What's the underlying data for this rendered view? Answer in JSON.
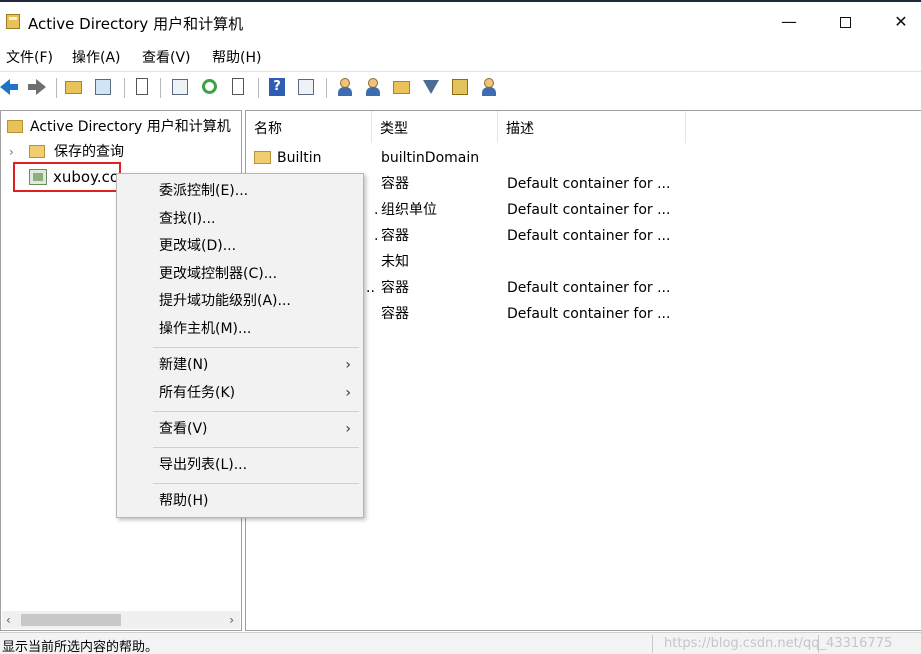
{
  "window": {
    "title": "Active Directory 用户和计算机",
    "minimize": "—",
    "close": "✕"
  },
  "menubar": [
    "文件(F)",
    "操作(A)",
    "查看(V)",
    "帮助(H)"
  ],
  "tree": {
    "root": "Active Directory 用户和计算机",
    "saved_queries": "保存的查询",
    "domain": "xuboy.co"
  },
  "list": {
    "columns": [
      "名称",
      "类型",
      "描述"
    ],
    "rows": [
      {
        "name": "Builtin",
        "type": "builtinDomain",
        "desc": ""
      },
      {
        "name": "",
        "type": "容器",
        "desc": "Default container for ..."
      },
      {
        "name": ".",
        "type": "组织单位",
        "desc": "Default container for ..."
      },
      {
        "name": ".",
        "type": "容器",
        "desc": "Default container for ..."
      },
      {
        "name": "",
        "type": "未知",
        "desc": ""
      },
      {
        "name": "..",
        "type": "容器",
        "desc": "Default container for ..."
      },
      {
        "name": "",
        "type": "容器",
        "desc": "Default container for ..."
      }
    ]
  },
  "context_menu": {
    "items": [
      {
        "label": "委派控制(E)...",
        "submenu": false
      },
      {
        "label": "查找(I)...",
        "submenu": false
      },
      {
        "label": "更改域(D)...",
        "submenu": false
      },
      {
        "label": "更改域控制器(C)...",
        "submenu": false
      },
      {
        "label": "提升域功能级别(A)...",
        "submenu": false
      },
      {
        "label": "操作主机(M)...",
        "submenu": false
      },
      {
        "label": "新建(N)",
        "submenu": true
      },
      {
        "label": "所有任务(K)",
        "submenu": true
      },
      {
        "label": "查看(V)",
        "submenu": true
      },
      {
        "label": "导出列表(L)...",
        "submenu": false
      },
      {
        "label": "帮助(H)",
        "submenu": false
      }
    ],
    "submenu_arrow": "›"
  },
  "statusbar": {
    "text": "显示当前所选内容的帮助。",
    "watermark": "https://blog.csdn.net/qq_43316775"
  },
  "scroll": {
    "left_arrow": "‹",
    "right_arrow": "›"
  },
  "colors": {
    "selection_outline": "#e02020",
    "folder": "#f0cd6f",
    "menu_background": "#f2f2f2"
  }
}
